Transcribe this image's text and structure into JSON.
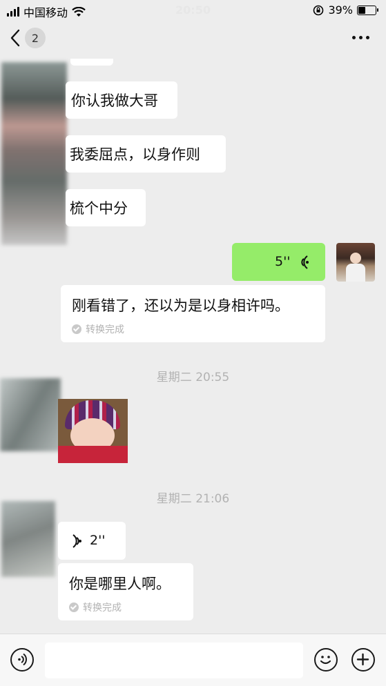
{
  "status": {
    "carrier": "中国移动",
    "time": "20:50",
    "battery": "39%",
    "battery_level": 0.39
  },
  "nav": {
    "unread_count": "2"
  },
  "messages": {
    "m1": "你认我做大哥",
    "m2": "我委屈点，以身作则",
    "m3": "梳个中分",
    "voice_out": "5''",
    "transcript1": "刚看错了，还以为是以身相许吗。",
    "transcript_note": "转换完成",
    "time1": "星期二 20:55",
    "time2": "星期二 21:06",
    "voice_in": "2''",
    "transcript2": "你是哪里人啊。"
  },
  "icons": {
    "signal": "cellular-signal-icon",
    "wifi": "wifi-icon",
    "lock": "rotation-lock-icon",
    "back": "chevron-left-icon",
    "more": "more-dots-icon",
    "voice": "voice-input-icon",
    "emoji": "emoji-icon",
    "add": "plus-circle-icon"
  }
}
